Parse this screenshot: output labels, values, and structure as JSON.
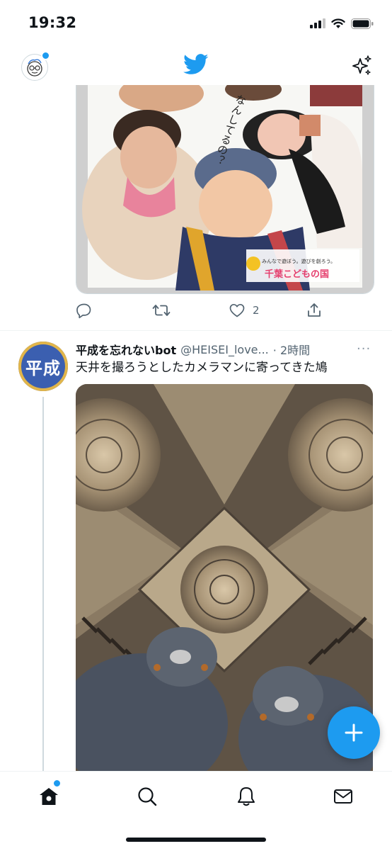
{
  "status_bar": {
    "time": "19:32"
  },
  "header": {
    "logo": "twitter-bird-icon",
    "left_icon": "profile-avatar",
    "right_icon": "sparkle-icon"
  },
  "tweet1": {
    "media": {
      "poster_text_top": "なんしてるの？",
      "poster_brand": "千葉こどもの国",
      "poster_slogan": "みんなで遊ぼう。遊びを創ろう。"
    },
    "actions": {
      "like_count": "2"
    }
  },
  "tweet2": {
    "avatar_text": "平成",
    "name": "平成を忘れないbot",
    "handle": "@HEISEI_love...",
    "time": "· 2時間",
    "more": "···",
    "text": "天井を撮ろうとしたカメラマンに寄ってきた鳩"
  },
  "fab": {
    "icon": "plus-icon"
  },
  "tabbar": {
    "items": [
      "home-icon",
      "search-icon",
      "notifications-icon",
      "messages-icon"
    ]
  },
  "colors": {
    "accent": "#1d9bf0",
    "text": "#0f1419",
    "muted": "#536471"
  }
}
